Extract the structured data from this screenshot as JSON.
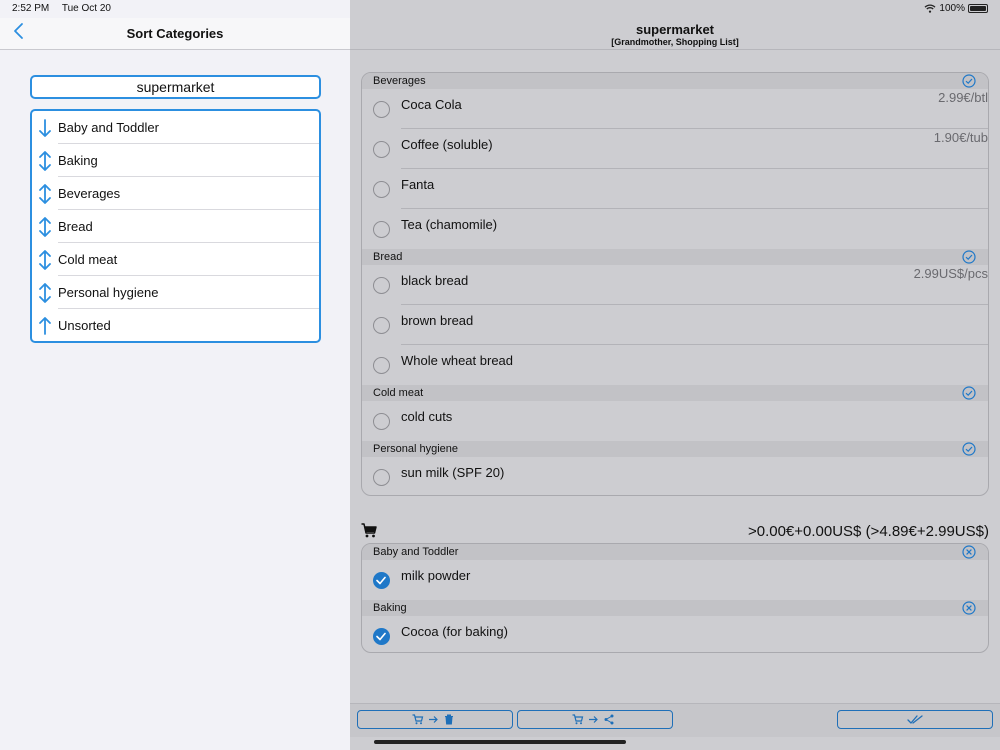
{
  "status": {
    "time": "2:52 PM",
    "date": "Tue Oct 20",
    "battery": "100%"
  },
  "left": {
    "title": "Sort Categories",
    "store_name": "supermarket",
    "categories": [
      {
        "label": "Baby and Toddler",
        "arrow": "arrow-down-icon"
      },
      {
        "label": "Baking",
        "arrow": "arrow-up-down-icon"
      },
      {
        "label": "Beverages",
        "arrow": "arrow-up-down-icon"
      },
      {
        "label": "Bread",
        "arrow": "arrow-up-down-icon"
      },
      {
        "label": "Cold meat",
        "arrow": "arrow-up-down-icon"
      },
      {
        "label": "Personal hygiene",
        "arrow": "arrow-up-down-icon"
      },
      {
        "label": "Unsorted",
        "arrow": "arrow-up-icon"
      }
    ]
  },
  "right": {
    "title": "supermarket",
    "subtitle": "[Grandmother, Shopping List]",
    "sections": [
      {
        "name": "Beverages",
        "items": [
          {
            "name": "Coca Cola",
            "price": "2.99€/btl"
          },
          {
            "name": "Coffee (soluble)",
            "price": "1.90€/tub"
          },
          {
            "name": "Fanta",
            "price": ""
          },
          {
            "name": "Tea (chamomile)",
            "price": ""
          }
        ]
      },
      {
        "name": "Bread",
        "items": [
          {
            "name": "black bread",
            "price": "2.99US$/pcs"
          },
          {
            "name": "brown bread",
            "price": ""
          },
          {
            "name": "Whole wheat bread",
            "price": ""
          }
        ]
      },
      {
        "name": "Cold meat",
        "items": [
          {
            "name": "cold cuts",
            "price": ""
          }
        ]
      },
      {
        "name": "Personal hygiene",
        "items": [
          {
            "name": "sun milk (SPF 20)",
            "price": ""
          }
        ]
      }
    ],
    "cart_total": ">0.00€+0.00US$ (>4.89€+2.99US$)",
    "cart_sections": [
      {
        "name": "Baby and Toddler",
        "items": [
          {
            "name": "milk powder"
          }
        ]
      },
      {
        "name": "Baking",
        "items": [
          {
            "name": "Cocoa (for baking)"
          }
        ]
      }
    ]
  },
  "colors": {
    "accent": "#2c8fe0",
    "checked": "#1f78c8"
  }
}
